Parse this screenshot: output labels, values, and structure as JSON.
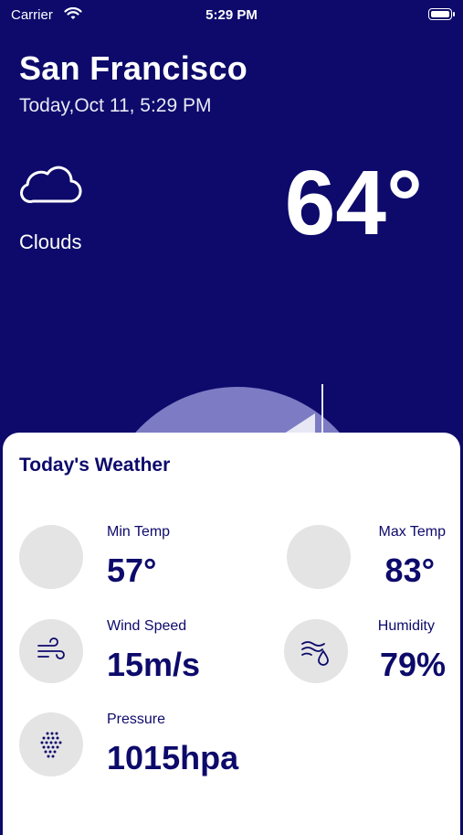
{
  "status_bar": {
    "carrier": "Carrier",
    "time": "5:29 PM"
  },
  "location": {
    "city": "San Francisco",
    "date": "Today,Oct 11, 5:29 PM"
  },
  "current": {
    "condition": "Clouds",
    "temperature": "64°",
    "icon": "cloud-icon"
  },
  "card": {
    "title": "Today's Weather",
    "stats": {
      "min_temp": {
        "label": "Min Temp",
        "value": "57°"
      },
      "max_temp": {
        "label": "Max Temp",
        "value": "83°"
      },
      "wind_speed": {
        "label": "Wind Speed",
        "value": "15m/s",
        "icon": "wind-icon"
      },
      "humidity": {
        "label": "Humidity",
        "value": "79%",
        "icon": "humidity-icon"
      },
      "pressure": {
        "label": "Pressure",
        "value": "1015hpa",
        "icon": "pressure-icon"
      }
    }
  },
  "colors": {
    "background": "#0d0a6b",
    "arc": "#7c7bc4",
    "card": "#ffffff",
    "text_dark": "#0d0a6b",
    "icon_bg": "#e4e4e4"
  }
}
